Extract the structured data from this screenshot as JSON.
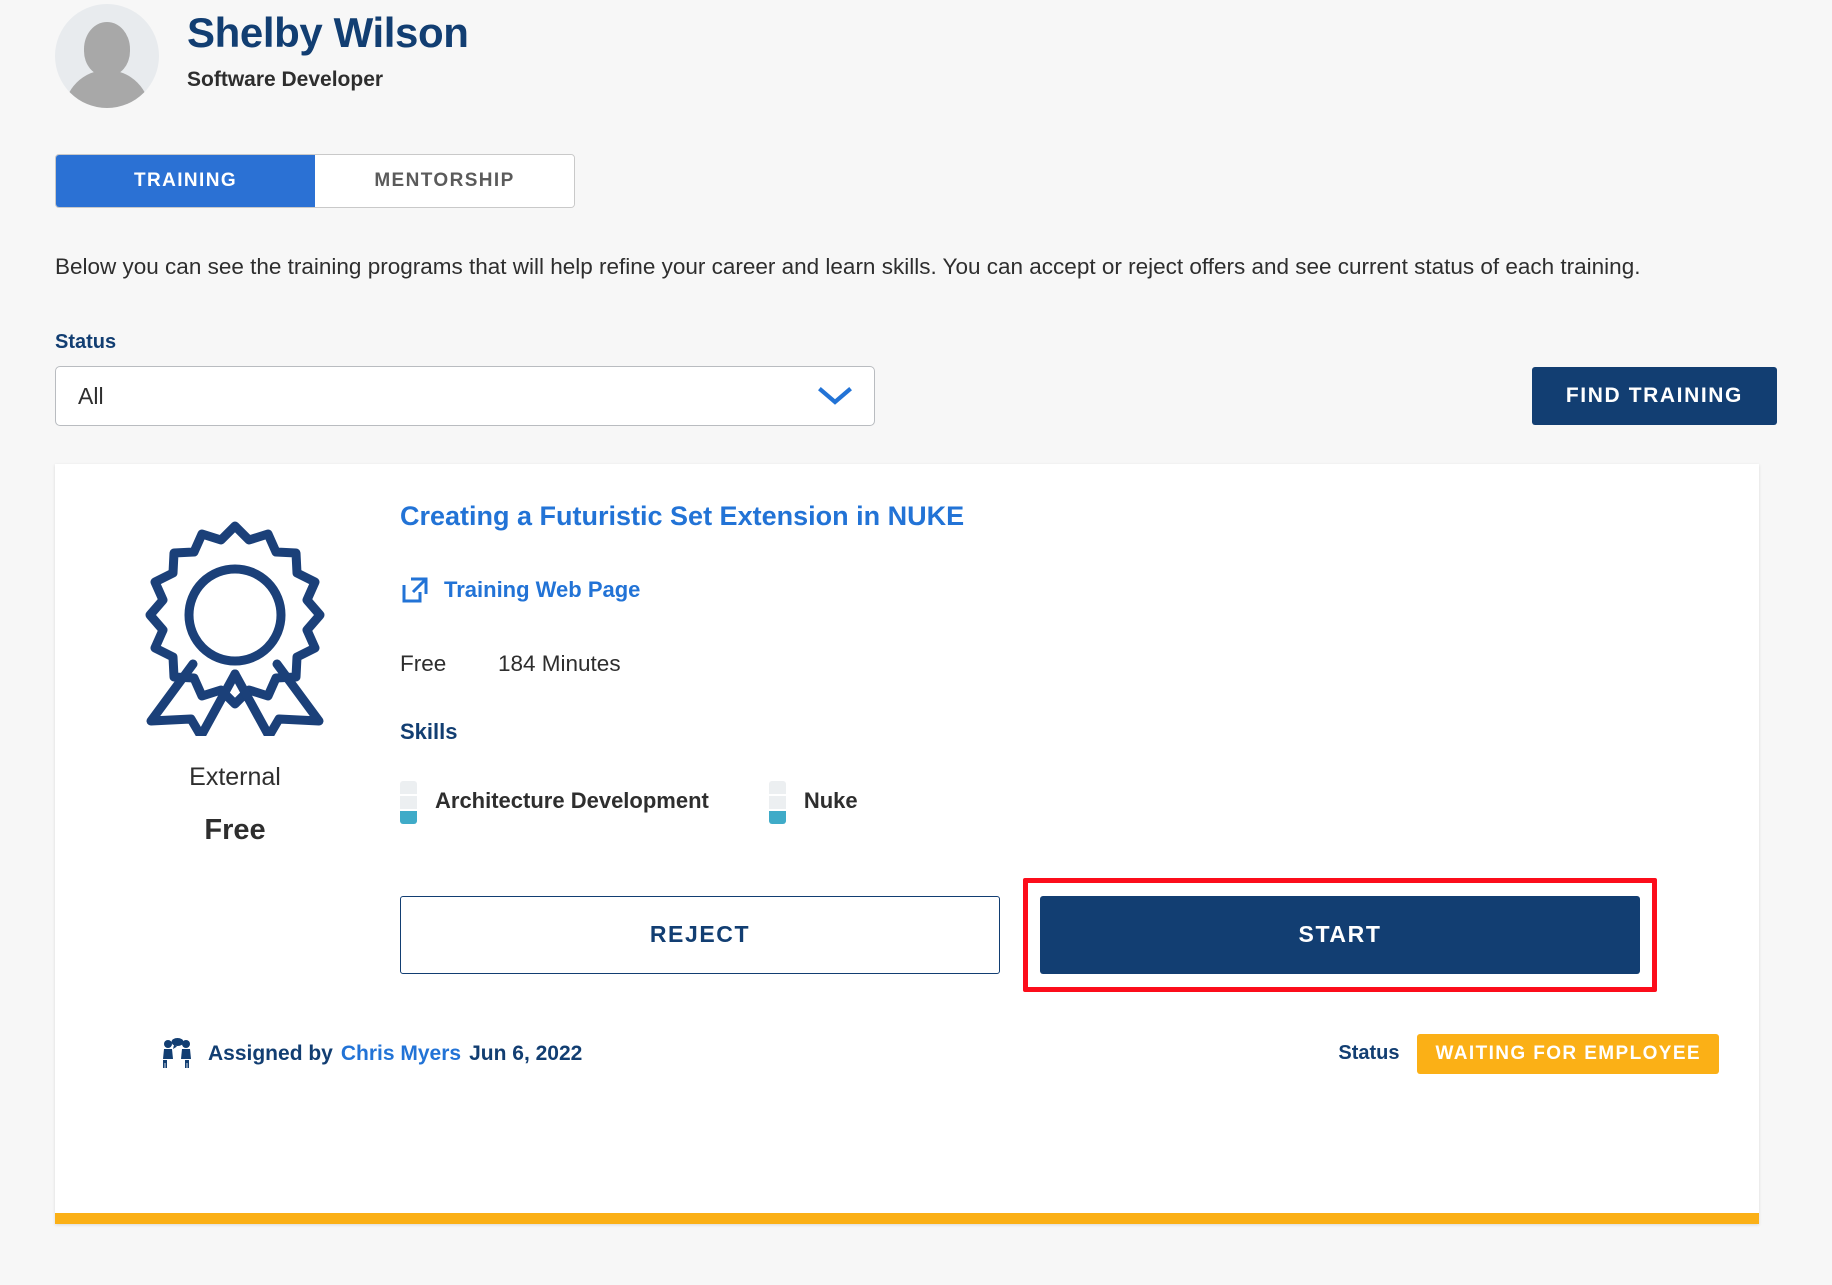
{
  "profile": {
    "name": "Shelby Wilson",
    "role": "Software Developer",
    "avatar_icon": "user-avatar-placeholder-icon"
  },
  "tabs": [
    {
      "label": "TRAINING",
      "active": true
    },
    {
      "label": "MENTORSHIP",
      "active": false
    }
  ],
  "description": "Below you can see the training programs that will help refine your career and learn skills. You can accept or reject offers and see current status of each training.",
  "filters": {
    "status_label": "Status",
    "status_value": "All",
    "status_placeholder": "All",
    "status_options": [
      "All"
    ],
    "chevron_icon": "chevron-down-icon",
    "find_training_label": "FIND TRAINING"
  },
  "training_card": {
    "badge_icon": "award-ribbon-icon",
    "source_type": "External",
    "price_label": "Free",
    "title": "Creating a Futuristic Set Extension in NUKE",
    "web_page_link": {
      "label": "Training Web Page",
      "icon": "external-link-icon"
    },
    "meta": {
      "cost": "Free",
      "duration": "184 Minutes"
    },
    "skills_heading": "Skills",
    "skills": [
      {
        "name": "Architecture Development",
        "level": 1,
        "levels_total": 3
      },
      {
        "name": "Nuke",
        "level": 1,
        "levels_total": 3
      }
    ],
    "actions": {
      "reject_label": "REJECT",
      "start_label": "START",
      "highlighted_action": "START"
    },
    "footer": {
      "assigned_icon": "people-meeting-icon",
      "assigned_by_label": "Assigned by",
      "assigned_by_person": "Chris Myers",
      "assigned_date": "Jun 6, 2022",
      "status_caption": "Status",
      "status_value": "WAITING FOR EMPLOYEE"
    }
  },
  "colors": {
    "navy": "#123e72",
    "bright_blue": "#2273d6",
    "tab_active_blue": "#2b71d4",
    "status_amber": "#fbb016",
    "skill_teal": "#3fabc8",
    "highlight_red": "#fc0d1b",
    "page_background": "#f7f7f7"
  }
}
